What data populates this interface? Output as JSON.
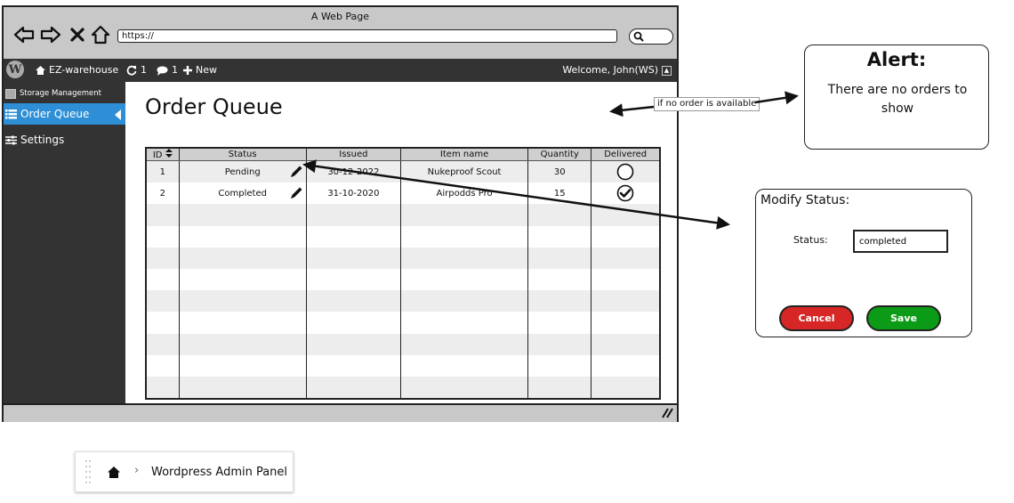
{
  "browser": {
    "title": "A Web Page",
    "url": "https://"
  },
  "admin_bar": {
    "site_name": "EZ-warehouse",
    "updates_count": "1",
    "comments_count": "1",
    "new_label": "New",
    "welcome": "Welcome, John(WS)"
  },
  "sidebar": {
    "items": [
      {
        "label": "Storage Management",
        "icon": "box-icon"
      },
      {
        "label": "Order Queue",
        "icon": "list-icon"
      },
      {
        "label": "Settings",
        "icon": "sliders-icon"
      }
    ]
  },
  "main": {
    "title": "Order Queue",
    "table": {
      "headers": [
        "ID",
        "Status",
        "Issued",
        "Item name",
        "Quantity",
        "Delivered"
      ],
      "rows": [
        {
          "id": "1",
          "status": "Pending",
          "issued": "30-12-2022",
          "item": "Nukeproof Scout",
          "quantity": "30",
          "delivered": false
        },
        {
          "id": "2",
          "status": "Completed",
          "issued": "31-10-2020",
          "item": "Airpodds Pro",
          "quantity": "15",
          "delivered": true
        }
      ]
    }
  },
  "annotation": {
    "note": "if no order is available"
  },
  "alert": {
    "title": "Alert:",
    "message": "There are no orders to show"
  },
  "modify_dialog": {
    "title": "Modify Status:",
    "status_label": "Status:",
    "status_value": "completed",
    "cancel_label": "Cancel",
    "save_label": "Save",
    "cancel_color": "#d62626",
    "save_color": "#0c9b16"
  },
  "breadcrumb": {
    "label": "Wordpress Admin Panel",
    "separator": "›"
  },
  "colors": {
    "admin_bar": "#333333",
    "active_item": "#2e8fd6"
  }
}
